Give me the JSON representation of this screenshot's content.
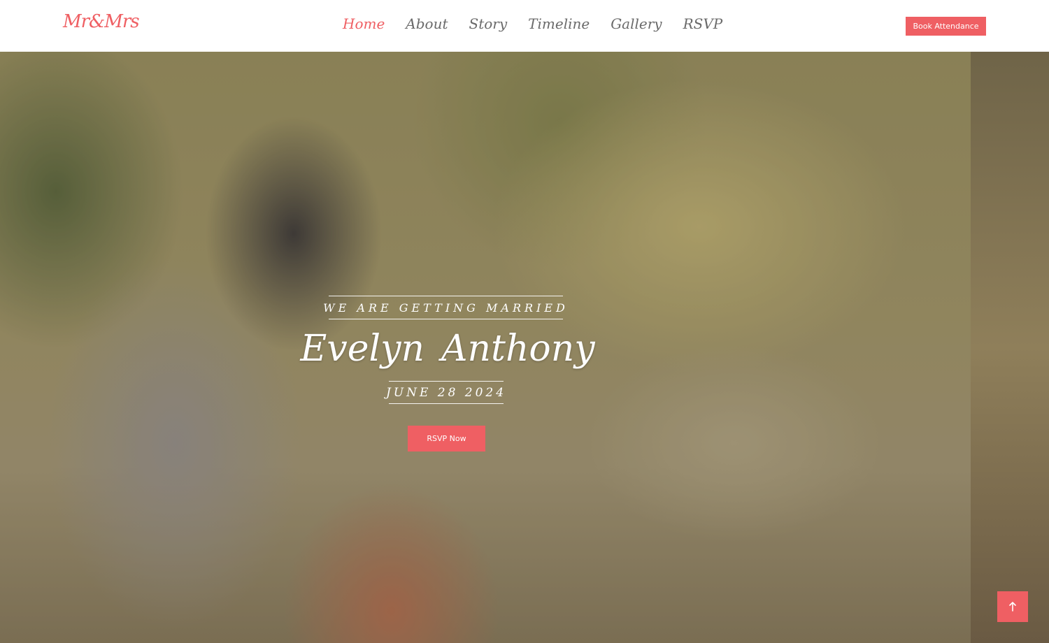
{
  "brand": {
    "logo_text": "Mr&Mrs"
  },
  "nav": {
    "items": [
      {
        "label": "Home"
      },
      {
        "label": "About"
      },
      {
        "label": "Story"
      },
      {
        "label": "Timeline"
      },
      {
        "label": "Gallery"
      },
      {
        "label": "RSVP"
      }
    ],
    "active": "Home",
    "cta_label": "Book Attendance"
  },
  "hero": {
    "tagline": "WE ARE GETTING MARRIED",
    "bride": "Evelyn",
    "groom": "Anthony",
    "date": "JUNE 28 2024",
    "cta_label": "RSVP Now",
    "separator_icon": "heart-icon"
  },
  "colors": {
    "accent": "#ef5f63",
    "nav_text": "#6a6a6a",
    "hero_text": "#ffffff"
  },
  "back_to_top_icon": "arrow-up-icon"
}
